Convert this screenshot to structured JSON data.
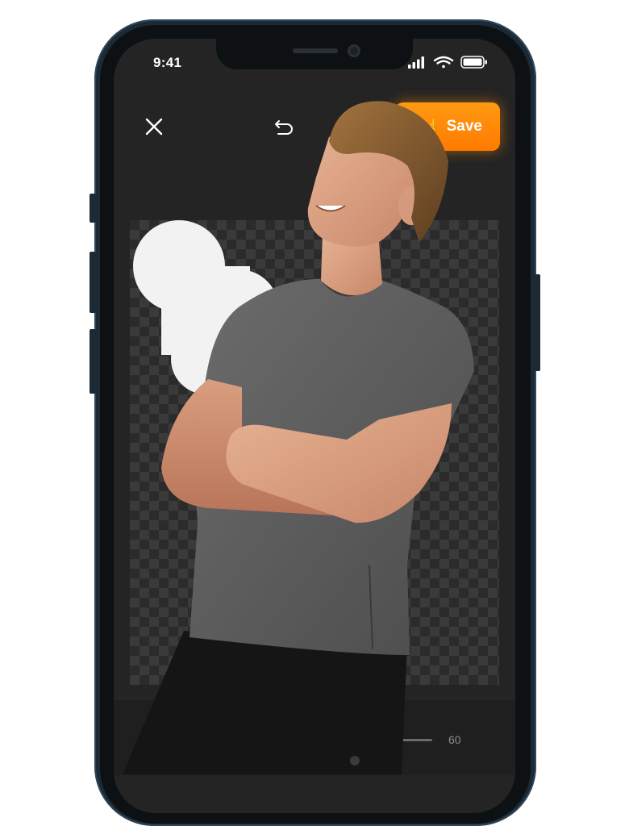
{
  "status_bar": {
    "time": "9:41"
  },
  "toolbar": {
    "close_icon": "close-icon",
    "undo_icon": "undo-icon",
    "save_label": "Save",
    "save_icon": "touch-hand-icon"
  },
  "colors": {
    "accent": "#ff8a00",
    "screen_background": "#242424",
    "phone_frame": "#1c2a36"
  },
  "editor": {
    "canvas_background": "transparent-checkerboard",
    "subject": "cut-out-person",
    "sticker_shape": "white-cloud"
  },
  "bottom_panel": {
    "slider_value": "60"
  }
}
